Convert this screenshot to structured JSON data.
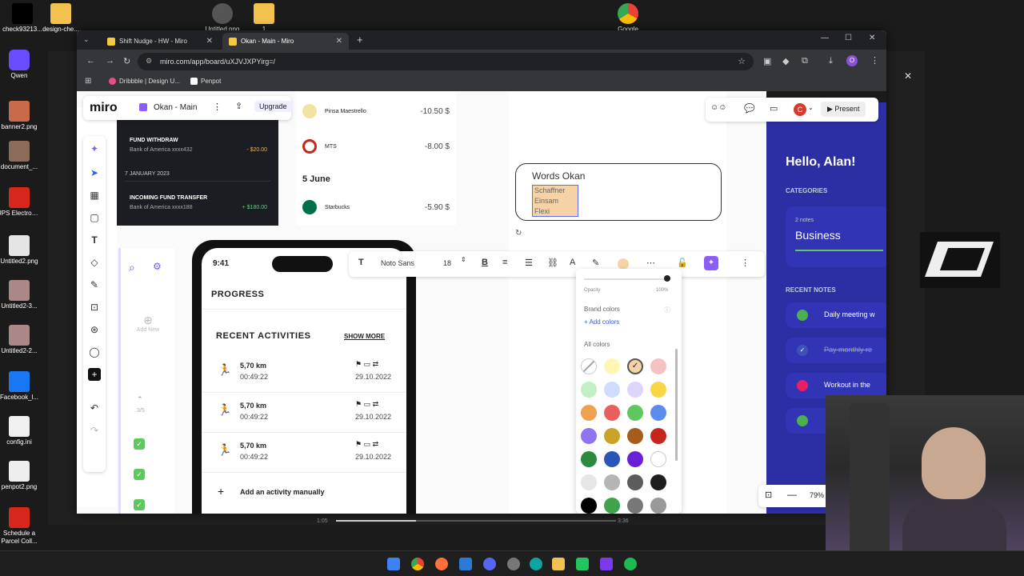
{
  "desktop": {
    "icons": [
      {
        "label": "check93213...",
        "color": "#000000"
      },
      {
        "label": "design-che...",
        "color": "#f2c14e"
      },
      {
        "label": "Qwen",
        "color": "#6a4cff"
      },
      {
        "label": "banner2.png",
        "color": "#c76b4b"
      },
      {
        "label": "document_...",
        "color": "#8b6b5a"
      },
      {
        "label": "UPS Electronic R...",
        "color": "#d9261c"
      },
      {
        "label": "Untitled2.png",
        "color": "#e5e5e5"
      },
      {
        "label": "Untitled2-3...",
        "color": "#a88"
      },
      {
        "label": "Untitled2-2...",
        "color": "#a88"
      },
      {
        "label": "Facebook_l...",
        "color": "#1877f2"
      },
      {
        "label": "config.ini",
        "color": "#f0f0f0"
      },
      {
        "label": "penpot2.png",
        "color": "#eeeeee"
      },
      {
        "label": "Schedule a Parcel Coll...",
        "color": "#d9261c"
      }
    ],
    "top_icons": [
      {
        "label": "Untitled.png"
      },
      {
        "label": "1"
      },
      {
        "label": "Google"
      }
    ]
  },
  "browser": {
    "tabs": [
      {
        "title": "Shift Nudge - HW - Miro"
      },
      {
        "title": "Okan - Main - Miro"
      }
    ],
    "new_tab": "+",
    "url": "miro.com/app/board/uXJVJXPYirg=/",
    "bookmarks": [
      {
        "label": "Dribbble | Design U...",
        "color": "#ea4c89"
      },
      {
        "label": "Penpot",
        "color": "#ffffff"
      }
    ],
    "profile_initial": "O"
  },
  "miro": {
    "logo": "miro",
    "board_name": "Okan - Main",
    "upgrade_label": "Upgrade",
    "present_label": "Present",
    "avatar_initial": "C",
    "zoom": "79%",
    "frames": {
      "fund_withdraw": {
        "title": "FUND WITHDRAW",
        "bank": "Bank of America xxxx432",
        "amount": "- $20.00"
      },
      "date_label": "7 JANUARY 2023",
      "incoming": {
        "title": "INCOMING FUND TRANSFER",
        "bank": "Bank of America xxxx188",
        "amount": "+ $180.00"
      },
      "transactions": [
        {
          "name": "Pinsa Maestrello",
          "amount": "-10.50 $"
        },
        {
          "name": "MTS",
          "amount": "-8.00 $"
        },
        {
          "name": "Starbucks",
          "amount": "-5.90 $"
        }
      ],
      "june_label": "5 June"
    },
    "phone": {
      "time": "9:41",
      "progress_title": "PROGRESS",
      "recent_title": "RECENT ACTIVITIES",
      "show_more": "SHOW MORE",
      "activities": [
        {
          "distance": "5,70 km",
          "duration": "00:49:22",
          "date": "29.10.2022"
        },
        {
          "distance": "5,70 km",
          "duration": "00:49:22",
          "date": "29.10.2022"
        },
        {
          "distance": "5,70 km",
          "duration": "00:49:22",
          "date": "29.10.2022"
        }
      ],
      "add_activity": "Add an activity manually"
    },
    "side_widget": {
      "add_new": "Add New",
      "pager": "3/5"
    },
    "text_card": {
      "title": "Words Okan",
      "lines": [
        "Schaffner",
        "Einsam",
        "Flexi"
      ]
    },
    "format_toolbar": {
      "font": "Noto Sans",
      "size": "18"
    },
    "color_picker": {
      "opacity_label": "Opacity",
      "opacity_value": "100%",
      "brand_colors": "Brand colors",
      "add_colors": "+ Add colors",
      "all_colors": "All colors",
      "swatches": [
        "#ffffff",
        "#fff6b6",
        "#f5d3a6",
        "#f4c2c2",
        "#c1f0c4",
        "#cfdcff",
        "#ddd4ff",
        "#f9d648",
        "#f0a150",
        "#ea5e5e",
        "#5ec85e",
        "#5b8def",
        "#8f75f0",
        "#c9a227",
        "#a65c1d",
        "#c4261d",
        "#2b8a3e",
        "#2a55b8",
        "#6b1fd6",
        "#ffffff",
        "#e6e6e6",
        "#b5b5b5",
        "#5c5c5c",
        "#1e1e1e",
        "#000000",
        "#3fa34d",
        "#777777",
        "#999999"
      ]
    },
    "notes_app": {
      "greeting": "Hello, Alan!",
      "categories": "CATEGORIES",
      "notes_count": "2 notes",
      "category": "Business",
      "recent_notes": "RECENT NOTES",
      "notes": [
        {
          "text": "Daily meeting w",
          "color": "#4caf50"
        },
        {
          "text": "Pay monthly re",
          "color": "#3f51b5"
        },
        {
          "text": "Workout in the",
          "color": "#e91e63"
        },
        {
          "text": "",
          "color": "#4caf50"
        }
      ]
    }
  },
  "video": {
    "current": "1:05",
    "total": "3:36"
  }
}
